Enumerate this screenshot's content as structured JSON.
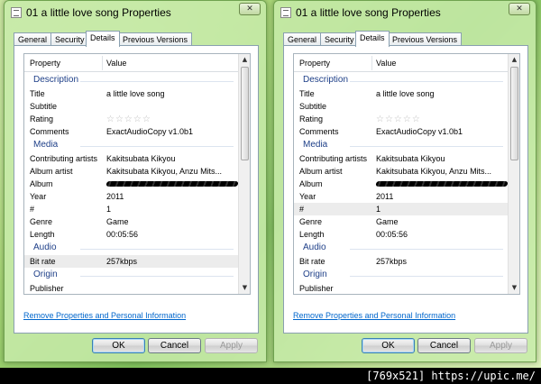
{
  "windows": [
    {
      "title": "01 a little love song Properties",
      "close_label": "✕",
      "tabs": [
        "General",
        "Security",
        "Details",
        "Previous Versions"
      ],
      "active_tab": "Details",
      "list": {
        "header_property": "Property",
        "header_value": "Value",
        "sections": [
          {
            "label": "Description",
            "rows": [
              {
                "p": "Title",
                "v": "a little love song"
              },
              {
                "p": "Subtitle",
                "v": ""
              },
              {
                "p": "Rating",
                "v": "☆☆☆☆☆"
              },
              {
                "p": "Comments",
                "v": "ExactAudioCopy v1.0b1"
              }
            ]
          },
          {
            "label": "Media",
            "rows": [
              {
                "p": "Contributing artists",
                "v": "Kakitsubata Kikyou"
              },
              {
                "p": "Album artist",
                "v": "Kakitsubata Kikyou, Anzu Mits..."
              },
              {
                "p": "Album",
                "v": "",
                "redacted": true
              },
              {
                "p": "Year",
                "v": "2011"
              },
              {
                "p": "#",
                "v": "1"
              },
              {
                "p": "Genre",
                "v": "Game"
              },
              {
                "p": "Length",
                "v": "00:05:56"
              }
            ]
          },
          {
            "label": "Audio",
            "rows": [
              {
                "p": "Bit rate",
                "v": "257kbps"
              }
            ]
          },
          {
            "label": "Origin",
            "rows": [
              {
                "p": "Publisher",
                "v": ""
              }
            ]
          }
        ]
      },
      "link": "Remove Properties and Personal Information",
      "buttons": {
        "ok": "OK",
        "cancel": "Cancel",
        "apply": "Apply"
      },
      "highlight_row": "Bit rate"
    },
    {
      "title": "01 a little love song Properties",
      "close_label": "✕",
      "tabs": [
        "General",
        "Security",
        "Details",
        "Previous Versions"
      ],
      "active_tab": "Details",
      "list": {
        "header_property": "Property",
        "header_value": "Value",
        "sections": [
          {
            "label": "Description",
            "rows": [
              {
                "p": "Title",
                "v": "a little love song"
              },
              {
                "p": "Subtitle",
                "v": ""
              },
              {
                "p": "Rating",
                "v": "☆☆☆☆☆"
              },
              {
                "p": "Comments",
                "v": "ExactAudioCopy v1.0b1"
              }
            ]
          },
          {
            "label": "Media",
            "rows": [
              {
                "p": "Contributing artists",
                "v": "Kakitsubata Kikyou"
              },
              {
                "p": "Album artist",
                "v": "Kakitsubata Kikyou, Anzu Mits..."
              },
              {
                "p": "Album",
                "v": "",
                "redacted": true
              },
              {
                "p": "Year",
                "v": "2011"
              },
              {
                "p": "#",
                "v": "1"
              },
              {
                "p": "Genre",
                "v": "Game"
              },
              {
                "p": "Length",
                "v": "00:05:56"
              }
            ]
          },
          {
            "label": "Audio",
            "rows": [
              {
                "p": "Bit rate",
                "v": "257kbps"
              }
            ]
          },
          {
            "label": "Origin",
            "rows": [
              {
                "p": "Publisher",
                "v": ""
              }
            ]
          }
        ]
      },
      "link": "Remove Properties and Personal Information",
      "buttons": {
        "ok": "OK",
        "cancel": "Cancel",
        "apply": "Apply"
      },
      "highlight_row": "#"
    }
  ],
  "footer": "[769x521] https://upic.me/"
}
